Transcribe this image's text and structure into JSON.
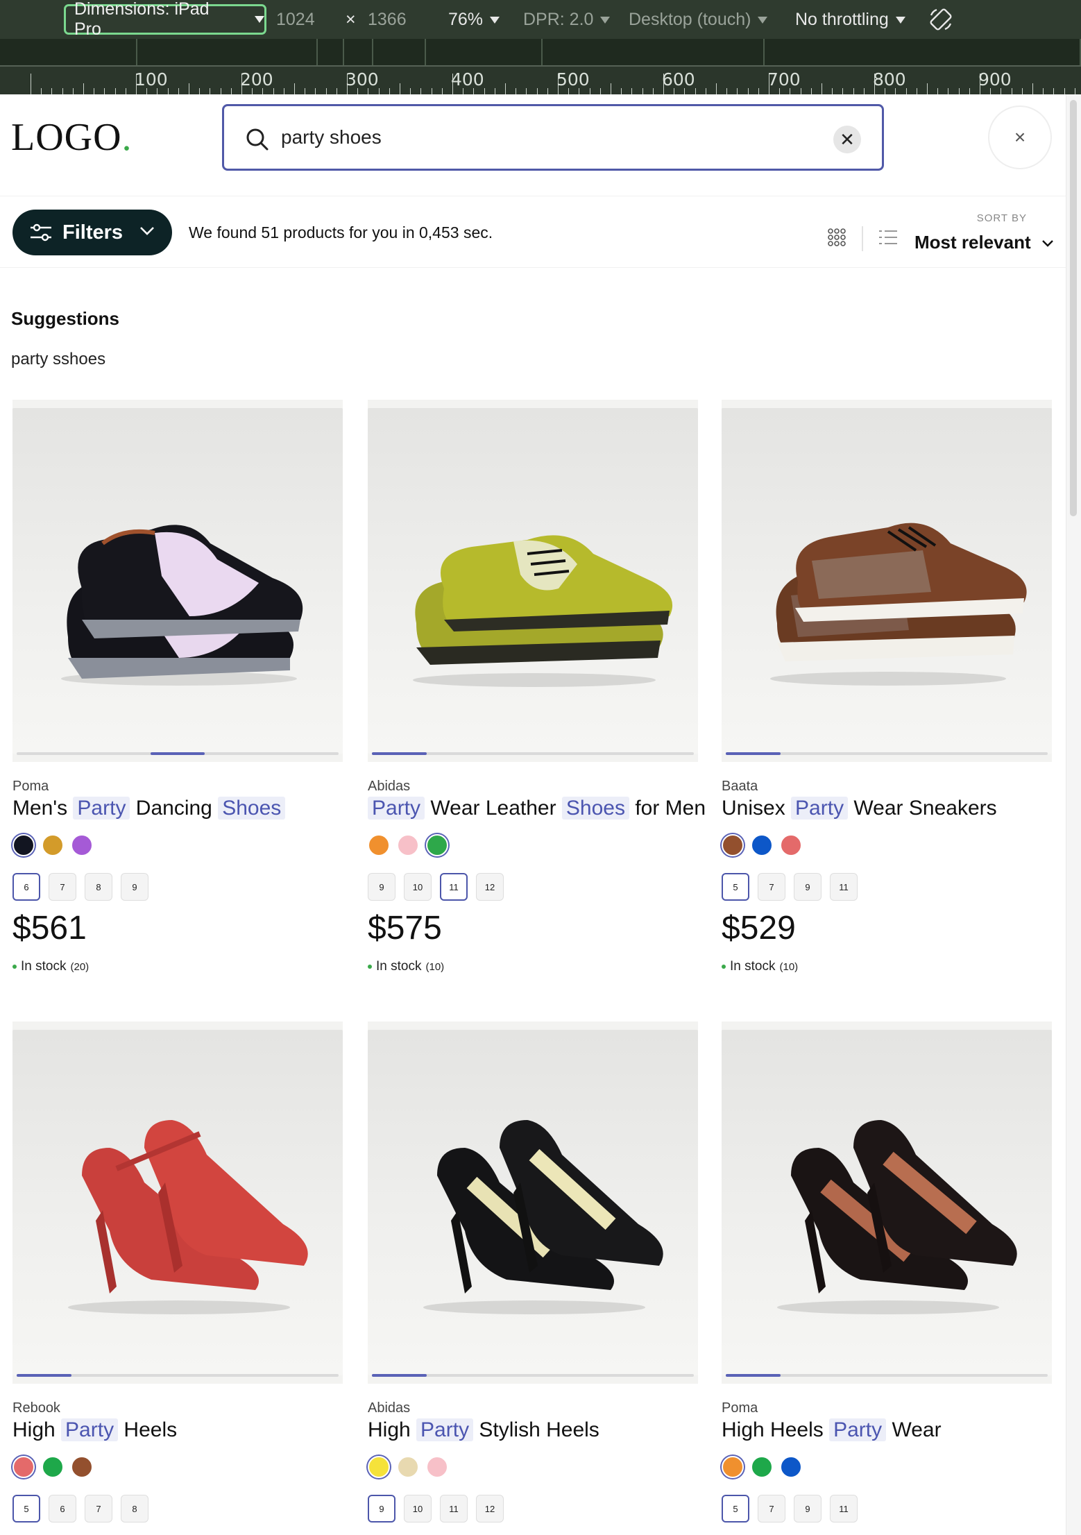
{
  "devtools": {
    "dimensions": "Dimensions: iPad Pro",
    "width": "1024",
    "times": "×",
    "height": "1366",
    "zoom": "76%",
    "dpr": "DPR: 2.0",
    "mode": "Desktop (touch)",
    "throttling": "No throttling",
    "ruler": [
      "100",
      "200",
      "300",
      "400",
      "500",
      "600",
      "700",
      "800",
      "900",
      "100"
    ]
  },
  "header": {
    "logo": "LOGO",
    "logo_dot": ".",
    "search_value": "party shoes",
    "clear_symbol": "✕",
    "close_symbol": "×"
  },
  "filterbar": {
    "filters_label": "Filters",
    "found_text": "We found 51 products for you in 0,453 sec.",
    "sort_by_label": "SORT BY",
    "sort_value": "Most relevant"
  },
  "suggestions": {
    "title": "Suggestions",
    "items": [
      "party sshoes"
    ]
  },
  "products": [
    {
      "brand": "Poma",
      "title_parts": [
        [
          "Men's ",
          false
        ],
        [
          "Party",
          true
        ],
        [
          " Dancing ",
          false
        ],
        [
          "Shoes",
          true
        ]
      ],
      "colors": [
        "#121521",
        "#d39b2a",
        "#a55ad6"
      ],
      "selected_color": 0,
      "sizes": [
        "6",
        "7",
        "8",
        "9"
      ],
      "selected_size": 0,
      "price": "$561",
      "stock_label": "In stock",
      "stock_count": "(20)",
      "image_progress": 0.5,
      "shoe": "oxford-black"
    },
    {
      "brand": "Abidas",
      "title_parts": [
        [
          "Party",
          true
        ],
        [
          " Wear Leather ",
          false
        ],
        [
          "Shoes",
          true
        ],
        [
          " for Men",
          false
        ]
      ],
      "colors": [
        "#f0902e",
        "#f7c0c8",
        "#2ea84a"
      ],
      "selected_color": 2,
      "sizes": [
        "9",
        "10",
        "11",
        "12"
      ],
      "selected_size": 2,
      "price": "$575",
      "stock_label": "In stock",
      "stock_count": "(10)",
      "image_progress": 0.0,
      "shoe": "brogue-green"
    },
    {
      "brand": "Baata",
      "title_parts": [
        [
          "Unisex ",
          false
        ],
        [
          "Party",
          true
        ],
        [
          " Wear Sneakers",
          false
        ]
      ],
      "colors": [
        "#93502e",
        "#0d57c8",
        "#e46a6a"
      ],
      "selected_color": 0,
      "sizes": [
        "5",
        "7",
        "9",
        "11"
      ],
      "selected_size": 0,
      "price": "$529",
      "stock_label": "In stock",
      "stock_count": "(10)",
      "image_progress": 0.0,
      "shoe": "sneaker-brown"
    },
    {
      "brand": "Rebook",
      "title_parts": [
        [
          "High ",
          false
        ],
        [
          "Party",
          true
        ],
        [
          " Heels",
          false
        ]
      ],
      "colors": [
        "#e46a6a",
        "#1ea84a",
        "#93502e"
      ],
      "selected_color": 0,
      "sizes": [
        "5",
        "6",
        "7",
        "8"
      ],
      "selected_size": 0,
      "price": "",
      "stock_label": "",
      "stock_count": "",
      "image_progress": 0.0,
      "shoe": "heel-red"
    },
    {
      "brand": "Abidas",
      "title_parts": [
        [
          "High ",
          false
        ],
        [
          "Party",
          true
        ],
        [
          " Stylish Heels",
          false
        ]
      ],
      "colors": [
        "#f5e23a",
        "#e8d9b0",
        "#f7c0c8"
      ],
      "selected_color": 0,
      "sizes": [
        "9",
        "10",
        "11",
        "12"
      ],
      "selected_size": 0,
      "price": "",
      "stock_label": "",
      "stock_count": "",
      "image_progress": 0.0,
      "shoe": "heel-black"
    },
    {
      "brand": "Poma",
      "title_parts": [
        [
          "High Heels ",
          false
        ],
        [
          "Party",
          true
        ],
        [
          " Wear",
          false
        ]
      ],
      "colors": [
        "#f0902e",
        "#1ea84a",
        "#0d57c8"
      ],
      "selected_color": 0,
      "sizes": [
        "5",
        "7",
        "9",
        "11"
      ],
      "selected_size": 0,
      "price": "",
      "stock_label": "",
      "stock_count": "",
      "image_progress": 0.0,
      "shoe": "heel-bronze"
    }
  ]
}
